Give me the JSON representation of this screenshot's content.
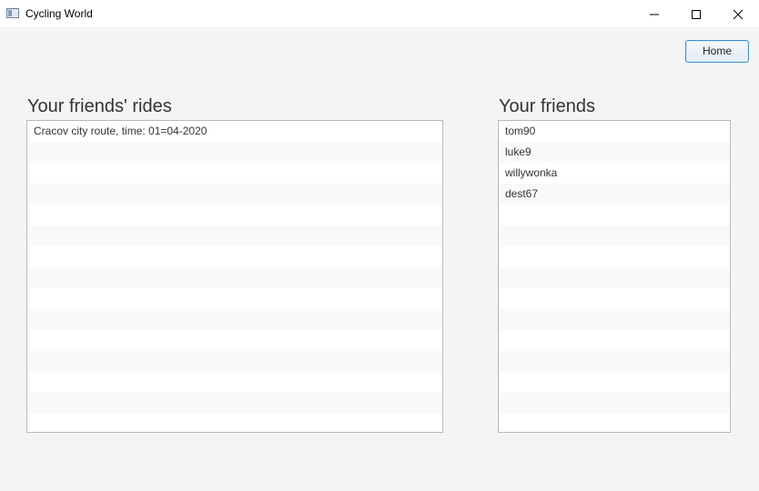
{
  "window": {
    "title": "Cycling World",
    "controls": [
      "minimize-icon",
      "maximize-icon",
      "close-icon"
    ]
  },
  "header": {
    "home_label": "Home"
  },
  "rides": {
    "title": "Your friends' rides",
    "items": [
      "Cracov city route, time: 01=04-2020"
    ]
  },
  "friends": {
    "title": "Your friends",
    "items": [
      "tom90",
      "luke9",
      "willywonka",
      "dest67"
    ]
  },
  "colors": {
    "accent": "#3f8fd2",
    "background": "#f4f4f4"
  }
}
